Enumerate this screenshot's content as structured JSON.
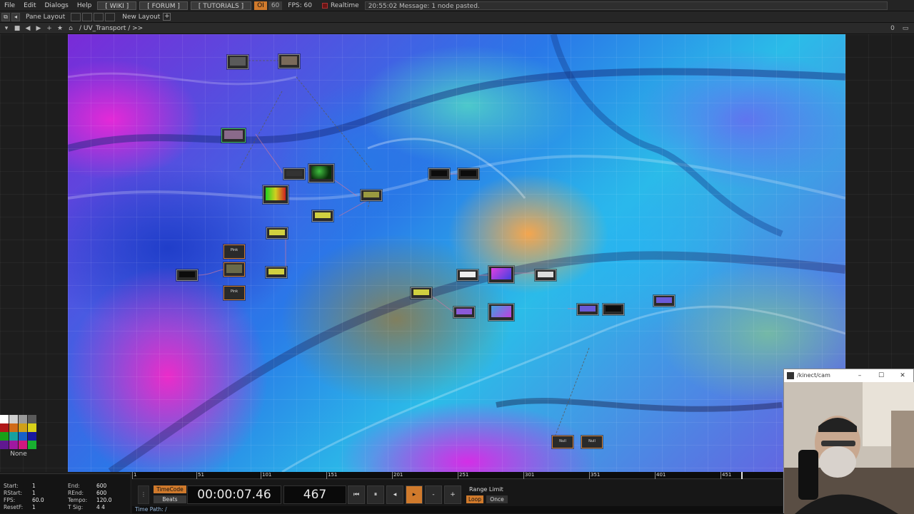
{
  "menu": {
    "items": [
      "File",
      "Edit",
      "Dialogs",
      "Help"
    ],
    "wiki": "[ WIKI ]",
    "forum": "[ FORUM ]",
    "tutorials": "[ TUTORIALS ]",
    "op_on": "OI",
    "op_off": "60",
    "fps": "FPS:  60",
    "realtime": "Realtime",
    "message": "20:55:02 Message: 1 node pasted."
  },
  "layout": {
    "pane_layout": "Pane Layout",
    "new_layout": "New Layout",
    "plus": "+"
  },
  "pathbar": {
    "path": "/  UV_Transport  /  >>",
    "right_value": "0"
  },
  "nodes": [
    {
      "name": "node-a",
      "label": ""
    },
    {
      "name": "node-b",
      "label": ""
    }
  ],
  "node_text": {
    "text_op_1": "Pink",
    "text_op_2": "Pink",
    "text_op_3": "Null",
    "text_op_4": "Null"
  },
  "palette": {
    "none_label": "None",
    "colors": [
      [
        "#ffffff",
        "#cfcfcf",
        "#9a9a9a",
        "#5a5a5a"
      ],
      [
        "#b01818",
        "#d06a18",
        "#d0a018",
        "#d8d018"
      ],
      [
        "#18a018",
        "#18a0a0",
        "#1860c8",
        "#1818a0"
      ],
      [
        "#601890",
        "#a018a0",
        "#d01880",
        "#18b030"
      ]
    ]
  },
  "info": {
    "start_label": "Start:",
    "start_value": "1",
    "end_label": "End:",
    "end_value": "600",
    "rstart_label": "RStart:",
    "rstart_value": "1",
    "rend_label": "REnd:",
    "rend_value": "600",
    "fps_label": "FPS:",
    "fps_value": "60.0",
    "tempo_label": "Tempo:",
    "tempo_value": "120.0",
    "resetf_label": "ResetF:",
    "resetf_value": "1",
    "tsig_label": "T Sig:",
    "tsig_value": "4     4"
  },
  "timeline": {
    "ticks": [
      "1",
      "51",
      "101",
      "151",
      "201",
      "251",
      "301",
      "351",
      "401",
      "451"
    ]
  },
  "transport": {
    "timecode_label": "TimeCode",
    "beats_label": "Beats",
    "timecode": "00:00:07.46",
    "frame": "467",
    "range_limit": "Range Limit",
    "loop": "Loop",
    "once": "Once",
    "plus": "+",
    "minus": "-"
  },
  "timepath": "Time Path: /",
  "webcam": {
    "title": "/kinect/cam"
  }
}
